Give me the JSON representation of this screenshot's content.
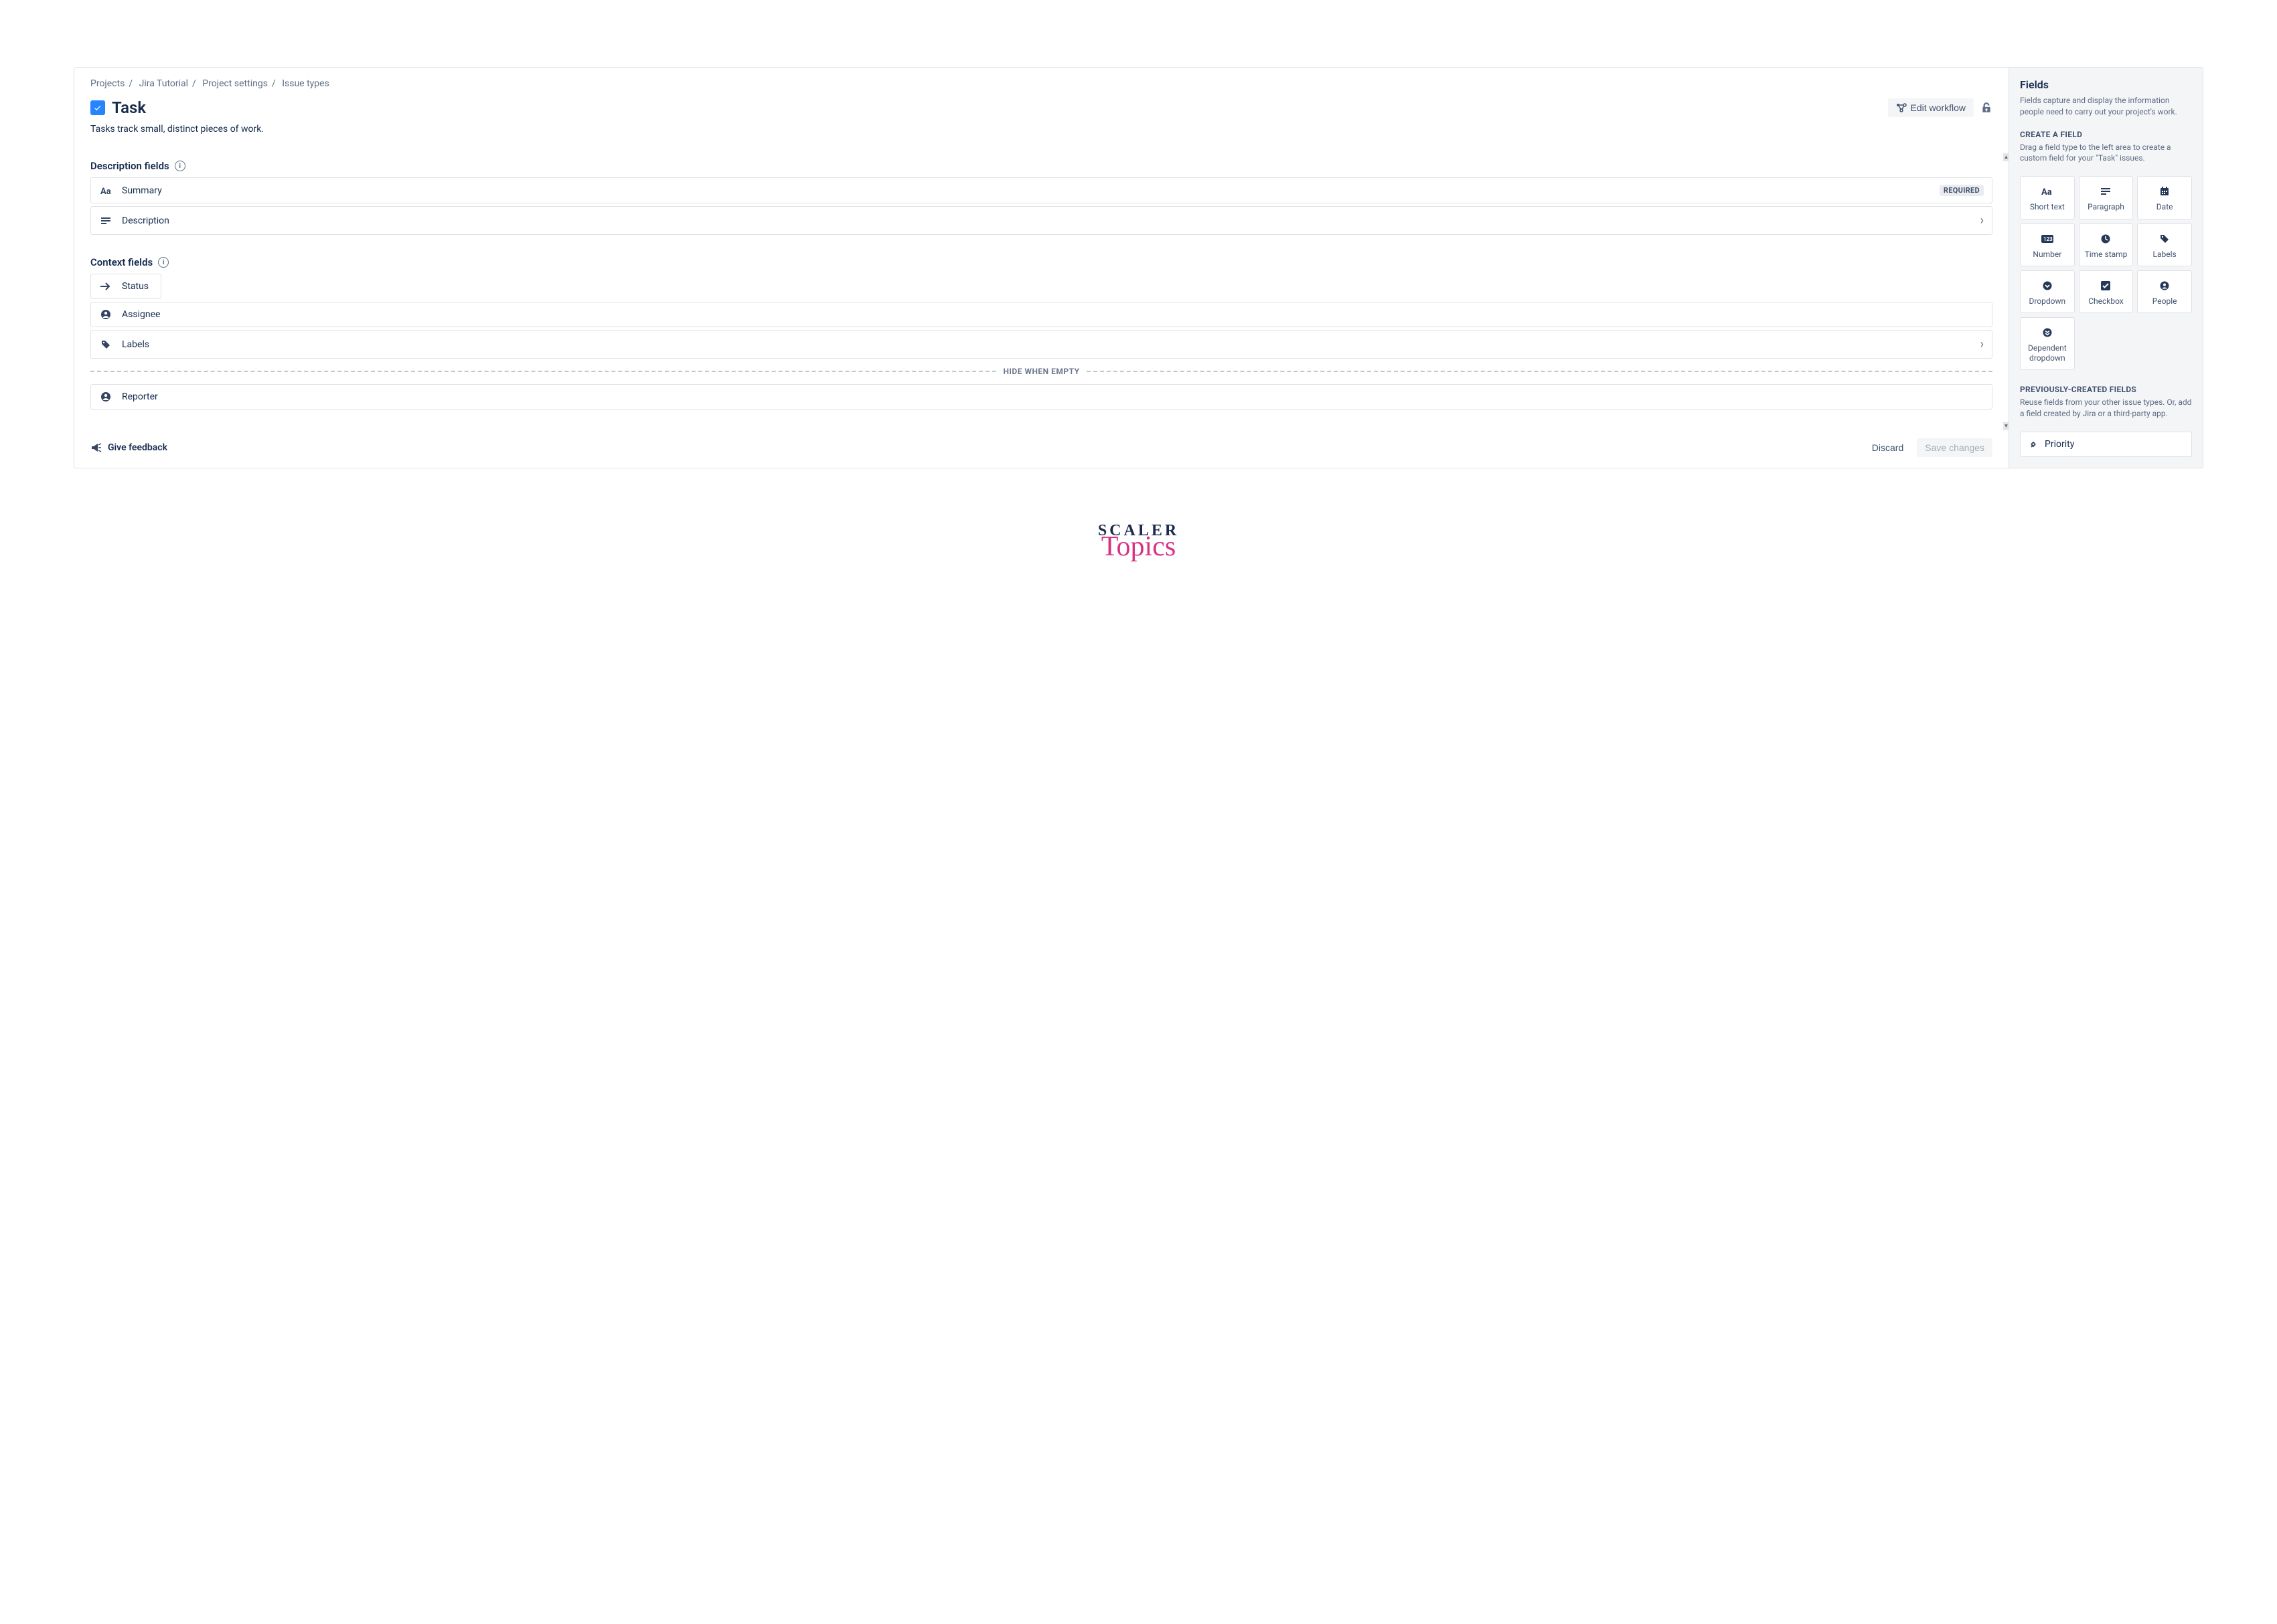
{
  "breadcrumbs": [
    "Projects",
    "Jira Tutorial",
    "Project settings",
    "Issue types"
  ],
  "header": {
    "title": "Task",
    "edit_workflow": "Edit workflow",
    "subtitle": "Tasks track small, distinct pieces of work."
  },
  "sections": {
    "description_fields_title": "Description fields",
    "context_fields_title": "Context fields",
    "hide_when_empty": "HIDE WHEN EMPTY"
  },
  "description_fields": [
    {
      "label": "Summary",
      "icon": "text",
      "required": true,
      "required_badge": "REQUIRED"
    },
    {
      "label": "Description",
      "icon": "paragraph",
      "expandable": true
    }
  ],
  "context_fields": [
    {
      "label": "Status",
      "icon": "arrow",
      "inline": true
    },
    {
      "label": "Assignee",
      "icon": "person"
    },
    {
      "label": "Labels",
      "icon": "tag",
      "expandable": true
    }
  ],
  "context_fields_hidden": [
    {
      "label": "Reporter",
      "icon": "person"
    }
  ],
  "footer": {
    "feedback": "Give feedback",
    "discard": "Discard",
    "save": "Save changes"
  },
  "sidebar": {
    "title": "Fields",
    "desc": "Fields capture and display the information people need to carry out your project's work.",
    "create_title": "CREATE A FIELD",
    "create_desc": "Drag a field type to the left area to create a custom field for your \"Task\" issues.",
    "field_types": [
      {
        "label": "Short text",
        "icon": "text"
      },
      {
        "label": "Paragraph",
        "icon": "paragraph"
      },
      {
        "label": "Date",
        "icon": "calendar"
      },
      {
        "label": "Number",
        "icon": "number"
      },
      {
        "label": "Time stamp",
        "icon": "clock"
      },
      {
        "label": "Labels",
        "icon": "tag"
      },
      {
        "label": "Dropdown",
        "icon": "dropdown"
      },
      {
        "label": "Checkbox",
        "icon": "checkbox"
      },
      {
        "label": "People",
        "icon": "people"
      },
      {
        "label": "Dependent dropdown",
        "icon": "dependent"
      }
    ],
    "prev_title": "PREVIOUSLY-CREATED FIELDS",
    "prev_desc": "Reuse fields from your other issue types. Or, add a field created by Jira or a third-party app.",
    "prev_fields": [
      {
        "label": "Priority",
        "icon": "priority"
      }
    ]
  },
  "logo": {
    "line1": "SCALER",
    "line2": "Topics"
  }
}
